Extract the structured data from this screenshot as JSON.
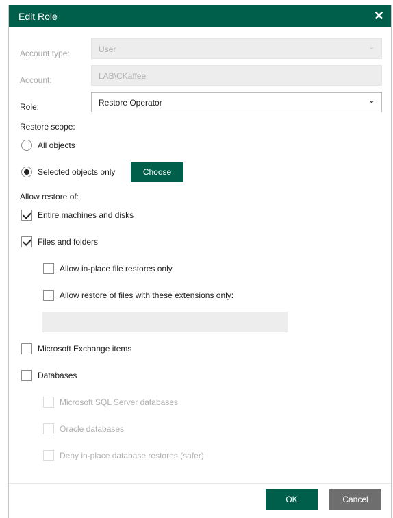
{
  "dialog": {
    "title": "Edit Role"
  },
  "fields": {
    "account_type_label": "Account type:",
    "account_type_value": "User",
    "account_label": "Account:",
    "account_value": "LAB\\CKaffee",
    "role_label": "Role:",
    "role_value": "Restore Operator"
  },
  "scope": {
    "heading": "Restore scope:",
    "all_objects": "All objects",
    "selected_only": "Selected objects only",
    "selected_option": "selected_only",
    "choose_button": "Choose"
  },
  "allow": {
    "heading": "Allow restore of:",
    "entire_machines": {
      "label": "Entire machines and disks",
      "checked": true
    },
    "files_folders": {
      "label": "Files and folders",
      "checked": true
    },
    "in_place_only": {
      "label": "Allow in-place file restores only",
      "checked": false
    },
    "extensions_only": {
      "label": "Allow restore of files with these extensions only:",
      "checked": false
    },
    "extensions_value": "",
    "exchange": {
      "label": "Microsoft Exchange items",
      "checked": false
    },
    "databases": {
      "label": "Databases",
      "checked": false
    },
    "sql": {
      "label": "Microsoft SQL Server databases",
      "checked": false,
      "disabled": true
    },
    "oracle": {
      "label": "Oracle databases",
      "checked": false,
      "disabled": true
    },
    "deny_in_place_db": {
      "label": "Deny in-place database restores (safer)",
      "checked": false,
      "disabled": true
    }
  },
  "footer": {
    "ok": "OK",
    "cancel": "Cancel"
  },
  "colors": {
    "accent": "#005f4b",
    "cancel": "#6e6e6e",
    "disabled_field": "#ededed"
  }
}
